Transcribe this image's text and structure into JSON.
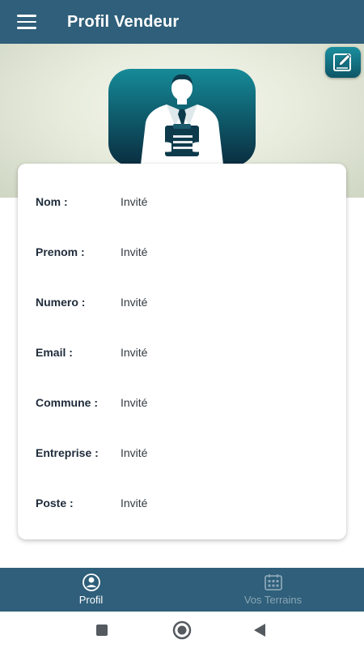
{
  "appbar": {
    "title": "Profil Vendeur"
  },
  "profile": {
    "fields": [
      {
        "label": "Nom :",
        "value": "Invité"
      },
      {
        "label": "Prenom :",
        "value": "Invité"
      },
      {
        "label": "Numero :",
        "value": "Invité"
      },
      {
        "label": "Email :",
        "value": "Invité"
      },
      {
        "label": "Commune :",
        "value": "Invité"
      },
      {
        "label": "Entreprise :",
        "value": "Invité"
      },
      {
        "label": "Poste :",
        "value": "Invité"
      }
    ]
  },
  "bottom_nav": {
    "items": [
      {
        "label": "Profil",
        "icon": "person-circle-icon",
        "active": true
      },
      {
        "label": "Vos Terrains",
        "icon": "calendar-grid-icon",
        "active": false
      }
    ]
  },
  "system_nav": {
    "icons": [
      "recents-square-icon",
      "home-circle-icon",
      "back-triangle-icon"
    ]
  },
  "colors": {
    "primary": "#2f5f7a",
    "card_bg": "#ffffff",
    "inactive_nav": "#8aa6b6"
  }
}
